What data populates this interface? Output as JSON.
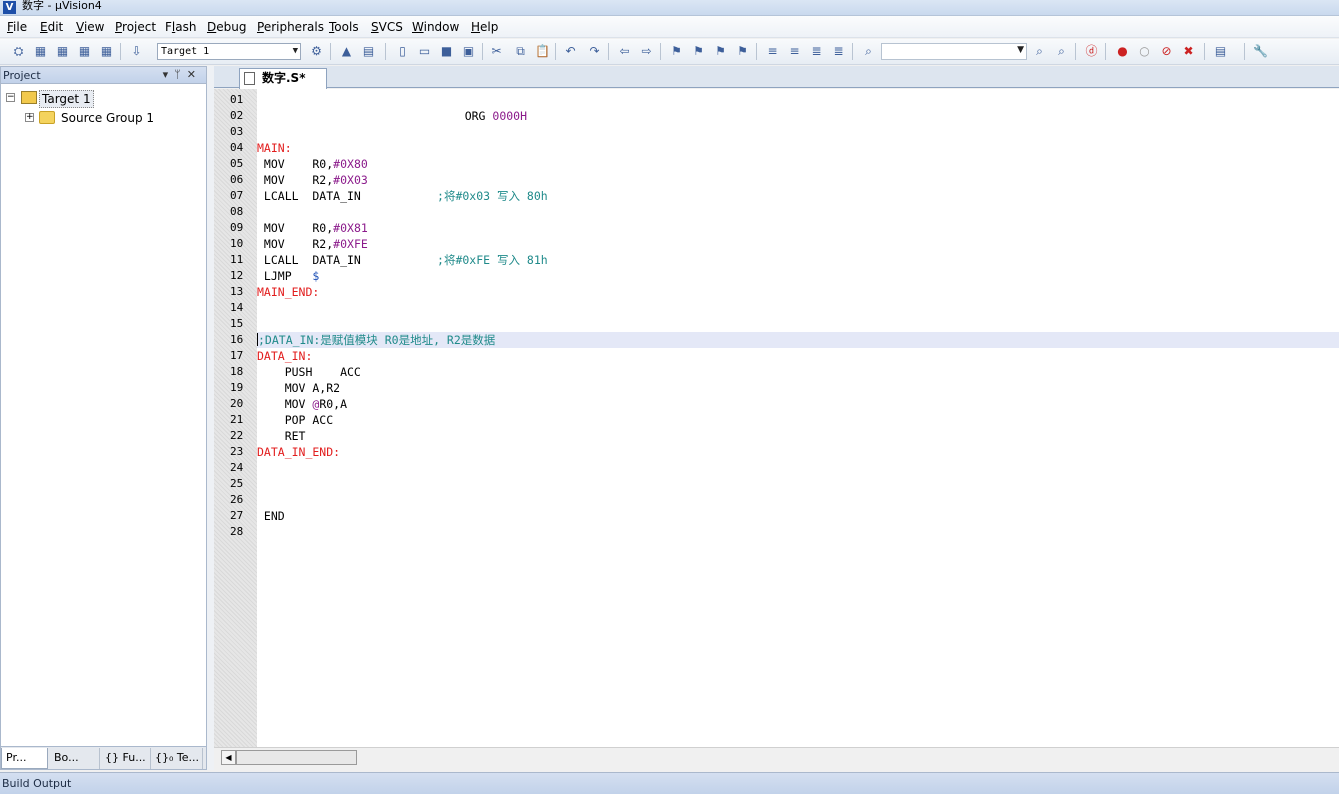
{
  "window": {
    "title": "数字  - µVision4"
  },
  "menu": {
    "items": [
      {
        "label": "File",
        "accel_index": 0
      },
      {
        "label": "Edit",
        "accel_index": 0
      },
      {
        "label": "View",
        "accel_index": 0
      },
      {
        "label": "Project",
        "accel_index": 0
      },
      {
        "label": "Flash",
        "accel_index": 1
      },
      {
        "label": "Debug",
        "accel_index": 0
      },
      {
        "label": "Peripherals",
        "accel_index": 0
      },
      {
        "label": "Tools",
        "accel_index": 0
      },
      {
        "label": "SVCS",
        "accel_index": 0
      },
      {
        "label": "Window",
        "accel_index": 0
      },
      {
        "label": "Help",
        "accel_index": 0
      }
    ]
  },
  "toolbar": {
    "target_value": "Target 1",
    "icons": [
      "translate-icon",
      "build-icon",
      "rebuild-icon",
      "batch-build-icon",
      "stop-build-icon",
      "download-icon",
      "target-options-icon",
      "manage-components-icon",
      "select-packs-icon",
      "new-file-icon",
      "open-file-icon",
      "save-icon",
      "save-all-icon",
      "cut-icon",
      "copy-icon",
      "paste-icon",
      "undo-icon",
      "redo-icon",
      "nav-back-icon",
      "nav-forward-icon",
      "bookmark-toggle-icon",
      "bookmark-prev-icon",
      "bookmark-next-icon",
      "bookmark-clear-icon",
      "indent-icon",
      "unindent-icon",
      "comment-icon",
      "uncomment-icon",
      "find-in-files-icon",
      "find-icon",
      "incremental-find-icon",
      "debug-session-icon",
      "insert-breakpoint-icon",
      "disable-breakpoint-icon",
      "kill-breakpoints-icon",
      "clear-breakpoints-icon",
      "window-layout-icon",
      "configure-icon"
    ]
  },
  "project_panel": {
    "title": "Project",
    "tree": {
      "target": "Target 1",
      "group": "Source Group 1"
    },
    "tabs": [
      "Pr...",
      "Bo...",
      "{} Fu...",
      "{}₀ Te..."
    ]
  },
  "editor": {
    "tab_label": "数字.S*",
    "lines": [
      {
        "n": "01",
        "tokens": []
      },
      {
        "n": "02",
        "tokens": [
          {
            "t": "                              ORG ",
            "c": "kw"
          },
          {
            "t": "0000H",
            "c": "num"
          }
        ]
      },
      {
        "n": "03",
        "tokens": []
      },
      {
        "n": "04",
        "tokens": [
          {
            "t": "MAIN:",
            "c": "label"
          }
        ]
      },
      {
        "n": "05",
        "tokens": [
          {
            "t": " MOV    R0,",
            "c": "kw"
          },
          {
            "t": "#0X80",
            "c": "num"
          }
        ]
      },
      {
        "n": "06",
        "tokens": [
          {
            "t": " MOV    R2,",
            "c": "kw"
          },
          {
            "t": "#0X03",
            "c": "num"
          }
        ]
      },
      {
        "n": "07",
        "tokens": [
          {
            "t": " LCALL  DATA_IN           ",
            "c": "kw"
          },
          {
            "t": ";将#0x03 写入 80h",
            "c": "cmt"
          }
        ]
      },
      {
        "n": "08",
        "tokens": []
      },
      {
        "n": "09",
        "tokens": [
          {
            "t": " MOV    R0,",
            "c": "kw"
          },
          {
            "t": "#0X81",
            "c": "num"
          }
        ]
      },
      {
        "n": "10",
        "tokens": [
          {
            "t": " MOV    R2,",
            "c": "kw"
          },
          {
            "t": "#0XFE",
            "c": "num"
          }
        ]
      },
      {
        "n": "11",
        "tokens": [
          {
            "t": " LCALL  DATA_IN           ",
            "c": "kw"
          },
          {
            "t": ";将#0xFE 写入 81h",
            "c": "cmt"
          }
        ]
      },
      {
        "n": "12",
        "tokens": [
          {
            "t": " LJMP   ",
            "c": "kw"
          },
          {
            "t": "$",
            "c": "sym"
          }
        ]
      },
      {
        "n": "13",
        "tokens": [
          {
            "t": "MAIN_END:",
            "c": "label"
          }
        ]
      },
      {
        "n": "14",
        "tokens": []
      },
      {
        "n": "15",
        "tokens": []
      },
      {
        "n": "16",
        "tokens": [
          {
            "t": ";DATA_IN:是赋值模块 R0是地址, R2是数据",
            "c": "cmt"
          }
        ],
        "current": true
      },
      {
        "n": "17",
        "tokens": [
          {
            "t": "DATA_IN:",
            "c": "label"
          }
        ]
      },
      {
        "n": "18",
        "tokens": [
          {
            "t": "    PUSH    ACC",
            "c": "kw"
          }
        ]
      },
      {
        "n": "19",
        "tokens": [
          {
            "t": "    MOV A,R2",
            "c": "kw"
          }
        ]
      },
      {
        "n": "20",
        "tokens": [
          {
            "t": "    MOV ",
            "c": "kw"
          },
          {
            "t": "@",
            "c": "num"
          },
          {
            "t": "R0,A",
            "c": "kw"
          }
        ]
      },
      {
        "n": "21",
        "tokens": [
          {
            "t": "    POP ACC",
            "c": "kw"
          }
        ]
      },
      {
        "n": "22",
        "tokens": [
          {
            "t": "    RET",
            "c": "kw"
          }
        ]
      },
      {
        "n": "23",
        "tokens": [
          {
            "t": "DATA_IN_END:",
            "c": "label"
          }
        ]
      },
      {
        "n": "24",
        "tokens": []
      },
      {
        "n": "25",
        "tokens": []
      },
      {
        "n": "26",
        "tokens": []
      },
      {
        "n": "27",
        "tokens": [
          {
            "t": " END",
            "c": "kw"
          }
        ]
      },
      {
        "n": "28",
        "tokens": []
      }
    ]
  },
  "build_output": {
    "title": "Build Output"
  }
}
